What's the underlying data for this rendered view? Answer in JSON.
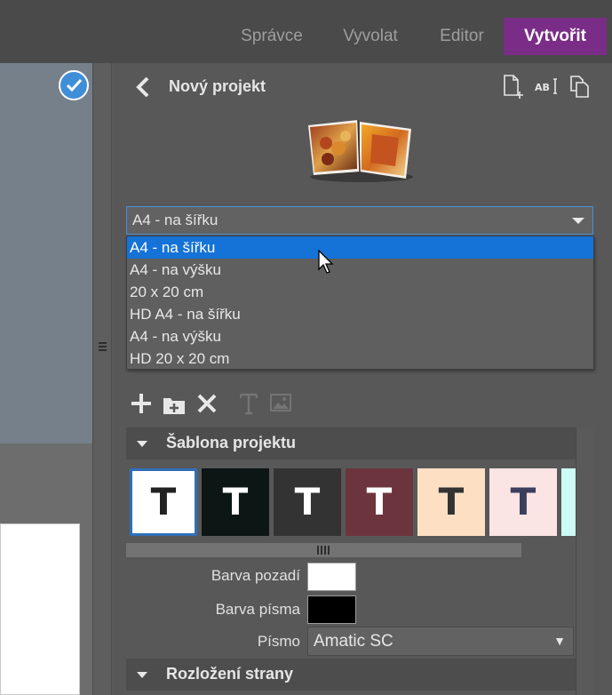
{
  "nav": {
    "tabs": [
      {
        "label": "Správce",
        "active": false
      },
      {
        "label": "Vyvolat",
        "active": false
      },
      {
        "label": "Editor",
        "active": false
      },
      {
        "label": "Vytvořit",
        "active": true
      }
    ],
    "active_color": "#7a2d86"
  },
  "panel": {
    "title": "Nový projekt",
    "header_icons": [
      "new-page-icon",
      "text-cursor-icon",
      "duplicate-icon"
    ]
  },
  "format": {
    "selected": "A4 - na šířku",
    "options": [
      "A4 - na šířku",
      "A4 - na výšku",
      "20 x 20 cm",
      "HD A4 - na šířku",
      "A4 - na výšku",
      "HD 20 x 20 cm"
    ],
    "highlight_color": "#1572d6"
  },
  "toolbar": {
    "icons": [
      "add-icon",
      "add-folder-icon",
      "delete-icon",
      "text-icon",
      "image-icon"
    ]
  },
  "template_section": {
    "title": "Šablona projektu",
    "swatches": [
      {
        "glyph": "T",
        "bg": "#ffffff",
        "fg": "#222222",
        "selected": true
      },
      {
        "glyph": "T",
        "bg": "#0c1614",
        "fg": "#ffffff",
        "selected": false
      },
      {
        "glyph": "T",
        "bg": "#333333",
        "fg": "#ffffff",
        "selected": false
      },
      {
        "glyph": "T",
        "bg": "#6c353d",
        "fg": "#ffffff",
        "selected": false
      },
      {
        "glyph": "T",
        "bg": "#fde0c4",
        "fg": "#333333",
        "selected": false
      },
      {
        "glyph": "T",
        "bg": "#fbe4e4",
        "fg": "#3b3f5c",
        "selected": false
      },
      {
        "glyph": "",
        "bg": "#cdfaf4",
        "fg": "#333333",
        "selected": false
      }
    ]
  },
  "form": {
    "bg_label": "Barva pozadí",
    "bg_color": "#ffffff",
    "fg_label": "Barva písma",
    "fg_color": "#000000",
    "font_label": "Písmo",
    "font_value": "Amatic SC"
  },
  "layout_section": {
    "title": "Rozložení strany"
  }
}
